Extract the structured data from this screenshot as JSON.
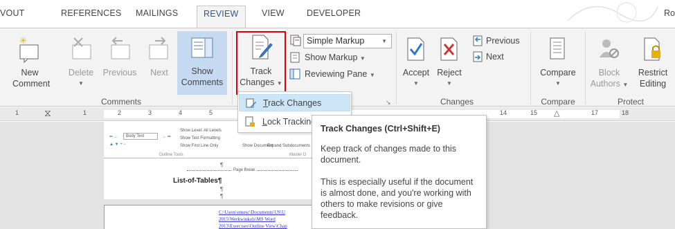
{
  "tabs": [
    {
      "label": "VOUT",
      "active": false
    },
    {
      "label": "REFERENCES",
      "active": false
    },
    {
      "label": "MAILINGS",
      "active": false
    },
    {
      "label": "REVIEW",
      "active": true
    },
    {
      "label": "VIEW",
      "active": false
    },
    {
      "label": "DEVELOPER",
      "active": false
    }
  ],
  "user_name": "Ro",
  "comments": {
    "new_line1": "New",
    "new_line2": "Comment",
    "delete": "Delete",
    "previous": "Previous",
    "next": "Next",
    "show_line1": "Show",
    "show_line2": "Comments",
    "group_label": "Comments"
  },
  "tracking": {
    "track_line1": "Track",
    "track_line2": "Changes",
    "markup_select": "Simple Markup",
    "show_markup": "Show Markup",
    "reviewing_pane": "Reviewing Pane"
  },
  "changes": {
    "accept": "Accept",
    "reject": "Reject",
    "previous": "Previous",
    "next": "Next",
    "group_label": "Changes"
  },
  "compare": {
    "label": "Compare",
    "group_label": "Compare"
  },
  "protect": {
    "block_line1": "Block",
    "block_line2": "Authors",
    "restrict_line1": "Restrict",
    "restrict_line2": "Editing",
    "group_label": "Protect"
  },
  "ruler_numbers": [
    "1",
    "1",
    "2",
    "3",
    "4",
    "5",
    "14",
    "15",
    "17",
    "18"
  ],
  "menu": {
    "item1": "Track Changes",
    "item2": "Lock Tracking"
  },
  "tooltip": {
    "title": "Track Changes (Ctrl+Shift+E)",
    "para1": "Keep track of changes made to this document.",
    "para2": "This is especially useful if the document is almost done, and you're working with others to make revisions or give feedback."
  },
  "document": {
    "body_text_select": "Body Text",
    "show_level": "Show Level: All Levels",
    "show_text_formatting": "Show Text Formatting",
    "show_first_line": "Show First Line Only",
    "outline_tools": "Outline Tools",
    "master_doc": "Master D",
    "show_doc": "Show Document",
    "expand_sub": "Expand Subdocuments",
    "pilcrow": "¶",
    "page_break": "Page Break",
    "list_title": "List-of-Tables¶",
    "link1": "C:\\Users\\ernesc\\Documents\\US\\U",
    "link2": "2015\\Werkwinkels\\MS Word",
    "link3": "2013\\Exercises\\Outline View\\Chap"
  },
  "colors": {
    "accent": "#2b579a",
    "highlight_box": "#e00000",
    "menu_highlight": "#cde6f7",
    "selected_button": "#c5daf1"
  }
}
